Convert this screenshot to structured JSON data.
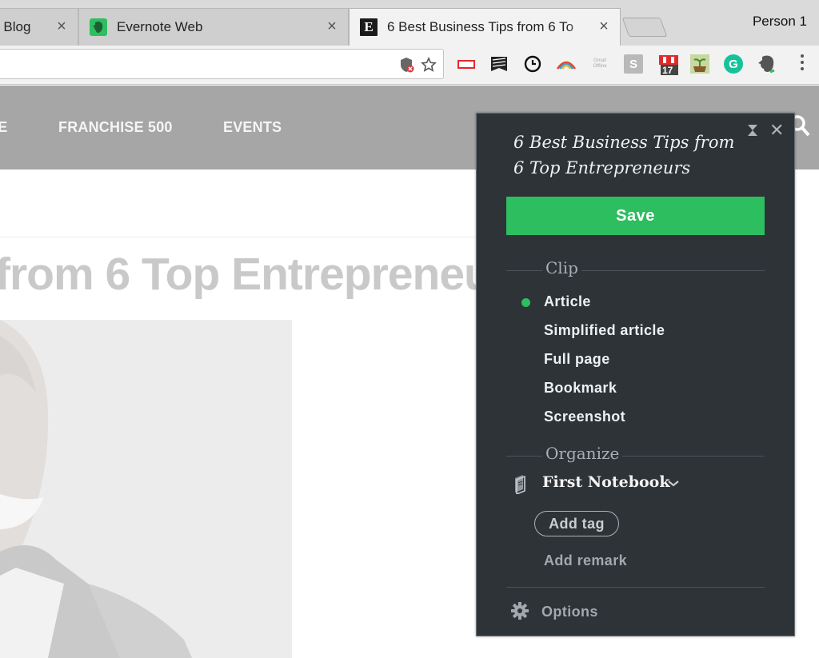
{
  "browser": {
    "tabs": [
      {
        "title": "r Blog",
        "favicon": "none",
        "active": false
      },
      {
        "title": "Evernote Web",
        "favicon": "evernote-elephant-icon",
        "active": false
      },
      {
        "title": "6 Best Business Tips from 6 To",
        "favicon": "entrepreneur-e-icon",
        "favicon_letter": "E",
        "active": true
      }
    ],
    "tab_close_glyph": "×",
    "profile_name": "Person 1",
    "extensions": [
      "shield-blocked-icon",
      "bookmark-star-icon",
      "red-rectangle-icon",
      "stripes-flag-icon",
      "clock-icon",
      "rainbow-arc-icon",
      "gmail-offline-icon",
      "s-badge-icon",
      "calendar-icon",
      "plant-pot-icon",
      "grammarly-icon",
      "evernote-icon"
    ],
    "calendar_day": "17",
    "gmail_label": "Gmail\nOffline",
    "s_badge_letter": "S",
    "grammarly_letter": "G"
  },
  "site": {
    "nav_links": [
      "IE",
      "FRANCHISE 500",
      "EVENTS"
    ],
    "headline": "from 6 Top Entrepreneu"
  },
  "clipper": {
    "title": "6 Best Business Tips from 6 Top Entrepreneurs",
    "save_label": "Save",
    "clip_section": "Clip",
    "clip_options": [
      "Article",
      "Simplified article",
      "Full page",
      "Bookmark",
      "Screenshot"
    ],
    "selected_clip": "Article",
    "organize_section": "Organize",
    "notebook": "First Notebook",
    "add_tag_label": "Add tag",
    "add_remark_label": "Add remark",
    "options_label": "Options",
    "close_glyph": "✕",
    "accent_color": "#2dbe60",
    "panel_bg": "#2e3338"
  }
}
